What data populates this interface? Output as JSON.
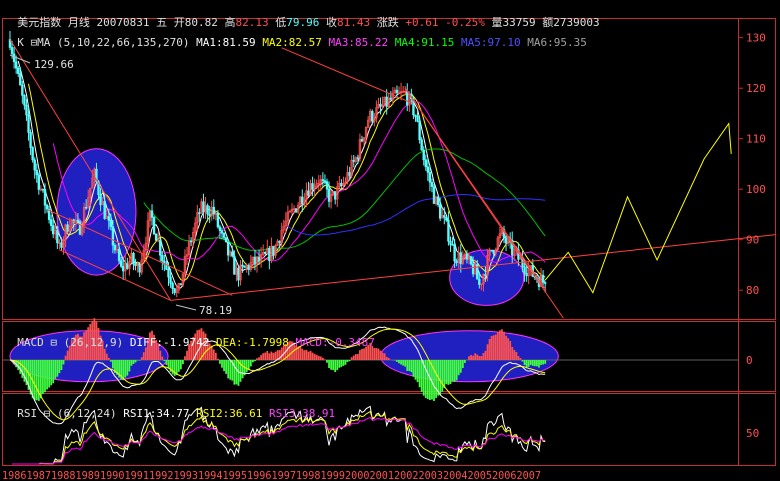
{
  "header": {
    "name": "美元指数",
    "period": "月线",
    "date": "20070831",
    "weekday": "五",
    "open_label": "开",
    "open": "80.82",
    "high_label": "高",
    "high": "82.13",
    "low_label": "低",
    "low": "79.96",
    "close_label": "收",
    "close": "81.43",
    "change_label": "涨跌",
    "change": "+0.61",
    "change_pct": "-0.25%",
    "volume_label": "量",
    "volume": "33759",
    "amount_label": "额",
    "amount": "2739003"
  },
  "ma_bar": {
    "prefix": "K",
    "name": "MA",
    "params": "(5,10,22,66,135,270)",
    "ma1": "MA1:81.59",
    "ma2": "MA2:82.57",
    "ma3": "MA3:85.22",
    "ma4": "MA4:91.15",
    "ma5": "MA5:97.10",
    "ma6": "MA6:95.35"
  },
  "macd_bar": {
    "name": "MACD",
    "params": "(26,12,9)",
    "diff": "DIFF:-1.9742",
    "dea": "DEA:-1.7998",
    "macd": "MACD:-0.3487"
  },
  "rsi_bar": {
    "name": "RSI",
    "params": "(6,12,24)",
    "rsi1": "RSI1:34.77",
    "rsi2": "RSI2:36.61",
    "rsi3": "RSI3:38.91"
  },
  "colors": {
    "bg": "#000000",
    "up": "#ff5050",
    "down": "#54ffff",
    "ma1": "#ffffff",
    "ma2": "#ffff00",
    "ma3": "#ff00ff",
    "ma4": "#00c000",
    "ma5": "#3030ff",
    "ma6": "#808080",
    "axis": "#c03030",
    "trend": "#ff4040",
    "forecast": "#ffff00",
    "ellipse": "#2020c0"
  },
  "chart_data": {
    "type": "candlestick",
    "price_axis": {
      "ticks": [
        80,
        90,
        100,
        110,
        120,
        130
      ],
      "range": [
        74.5,
        133.5
      ]
    },
    "annotations": {
      "high": "129.66",
      "low": "78.19"
    },
    "x_labels": [
      "1986",
      "1987",
      "1988",
      "1989",
      "1990",
      "1991",
      "1992",
      "1993",
      "1994",
      "1995",
      "1996",
      "1997",
      "1998",
      "1999",
      "2000",
      "2001",
      "2002",
      "2003",
      "2004",
      "2005",
      "2006",
      "2007"
    ],
    "year_start": 1986,
    "close_keypoints": [
      [
        1986.0,
        129.66
      ],
      [
        1986.5,
        118
      ],
      [
        1987.0,
        104
      ],
      [
        1987.5,
        96
      ],
      [
        1988.0,
        88
      ],
      [
        1988.4,
        94
      ],
      [
        1988.8,
        92
      ],
      [
        1989.4,
        103
      ],
      [
        1989.8,
        96
      ],
      [
        1990.5,
        84
      ],
      [
        1990.9,
        86
      ],
      [
        1991.2,
        84
      ],
      [
        1991.7,
        95
      ],
      [
        1992.2,
        86
      ],
      [
        1992.8,
        79
      ],
      [
        1993.2,
        88
      ],
      [
        1993.7,
        96
      ],
      [
        1994.2,
        96
      ],
      [
        1994.6,
        90
      ],
      [
        1995.2,
        83
      ],
      [
        1995.7,
        85
      ],
      [
        1996.2,
        86
      ],
      [
        1996.7,
        88
      ],
      [
        1997.0,
        92
      ],
      [
        1997.5,
        96
      ],
      [
        1998.0,
        100
      ],
      [
        1998.5,
        102
      ],
      [
        1999.0,
        98
      ],
      [
        1999.5,
        101
      ],
      [
        2000.0,
        106
      ],
      [
        2000.5,
        114
      ],
      [
        2001.0,
        116
      ],
      [
        2001.5,
        118
      ],
      [
        2002.0,
        119
      ],
      [
        2002.4,
        115
      ],
      [
        2002.8,
        105
      ],
      [
        2003.2,
        98
      ],
      [
        2003.7,
        92
      ],
      [
        2004.0,
        87
      ],
      [
        2004.4,
        86
      ],
      [
        2004.8,
        84
      ],
      [
        2005.0,
        81
      ],
      [
        2005.5,
        88
      ],
      [
        2005.9,
        91
      ],
      [
        2006.3,
        88
      ],
      [
        2006.8,
        85
      ],
      [
        2007.2,
        83
      ],
      [
        2007.67,
        81.43
      ]
    ],
    "ellipses": [
      {
        "pane": "price",
        "center": [
          1989.5,
          95.5
        ],
        "radius_years": [
          1.6,
          12.5
        ]
      },
      {
        "pane": "price",
        "center": [
          2005.3,
          82.5
        ],
        "radius_years": [
          1.5,
          5.5
        ]
      },
      {
        "pane": "macd",
        "center": [
          1989.2,
          0.5
        ],
        "radius_years": [
          3.2,
          1
        ]
      },
      {
        "pane": "macd",
        "center": [
          2004.6,
          0.5
        ],
        "radius_years": [
          3.6,
          1
        ]
      }
    ],
    "forecast_path": [
      [
        2007.67,
        82
      ],
      [
        2008.6,
        87.5
      ],
      [
        2009.6,
        79.5
      ],
      [
        2011.0,
        98.5
      ],
      [
        2012.2,
        86
      ],
      [
        2014.1,
        106
      ],
      [
        2015.1,
        113
      ],
      [
        2015.2,
        107
      ]
    ],
    "trendlines": [
      {
        "from": [
          1986.0,
          129.66
        ],
        "to": [
          1992.5,
          78
        ]
      },
      {
        "from": [
          1988.0,
          88
        ],
        "to": [
          1992.5,
          78
        ]
      },
      {
        "from": [
          1987.5,
          96
        ],
        "to": [
          1995.0,
          79
        ]
      },
      {
        "from": [
          1992.5,
          78
        ],
        "to": [
          2017.0,
          91
        ]
      },
      {
        "from": [
          2002.0,
          120
        ],
        "to": [
          2008.4,
          74.5
        ]
      },
      {
        "from": [
          1997.0,
          128.0
        ],
        "to": [
          2002.3,
          117
        ]
      },
      {
        "from": [
          2002.0,
          120
        ],
        "to": [
          2007.7,
          80
        ]
      }
    ],
    "macd_axis": {
      "ticks": [
        0
      ],
      "range": [
        -4,
        4
      ]
    },
    "rsi_axis": {
      "ticks": [
        50
      ],
      "range": [
        0,
        100
      ]
    }
  }
}
